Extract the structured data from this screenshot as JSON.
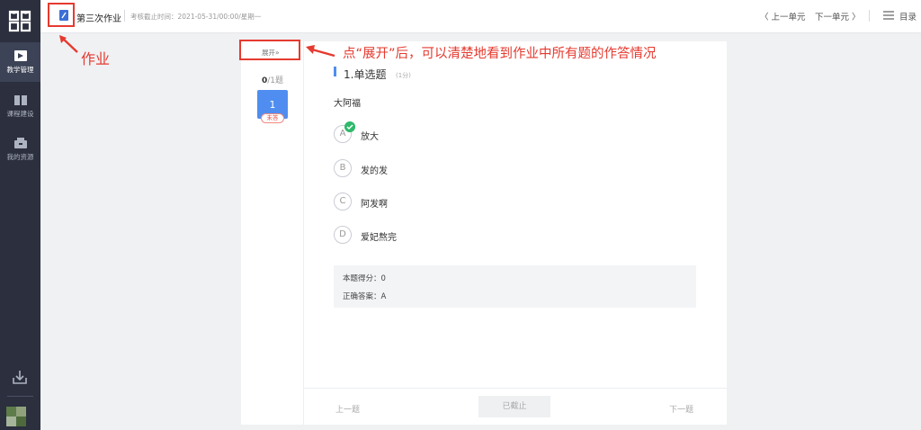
{
  "sidebar": {
    "items": [
      {
        "label": "教学管理",
        "icon": "teaching-icon",
        "active": true
      },
      {
        "label": "课程建设",
        "icon": "book-icon",
        "active": false
      },
      {
        "label": "我的资源",
        "icon": "box-icon",
        "active": false
      }
    ]
  },
  "header": {
    "title": "第三次作业",
    "deadline": "考核截止时间：2021-05-31/00:00/星期一",
    "prev_unit": "〈 上一单元",
    "next_unit": "下一单元 〉",
    "menu_label": "目录"
  },
  "card": {
    "expand_label": "展开»",
    "score_done": "0",
    "score_total": "/1题",
    "question_number": "1",
    "question_status": "未答",
    "question_title": "1.单选题",
    "question_score": "(1分)",
    "question_text": "大阿福",
    "options": [
      {
        "letter": "A",
        "text": "放大",
        "correct": true
      },
      {
        "letter": "B",
        "text": "发的发",
        "correct": false
      },
      {
        "letter": "C",
        "text": "阿发啊",
        "correct": false
      },
      {
        "letter": "D",
        "text": "爱妃熬完",
        "correct": false
      }
    ],
    "score_line": "本题得分：0",
    "answer_line": "正确答案：A",
    "prev_question": "上一题",
    "deadline_button": "已截止",
    "next_question": "下一题"
  },
  "annotations": {
    "homework_label": "作业",
    "expand_note": "点“展开”后，可以清楚地看到作业中所有题的作答情况",
    "color": "#e53a2f"
  },
  "colors": {
    "accent": "#4f8ef0",
    "sidebar": "#2b2f3e",
    "correct": "#2fb96b"
  }
}
